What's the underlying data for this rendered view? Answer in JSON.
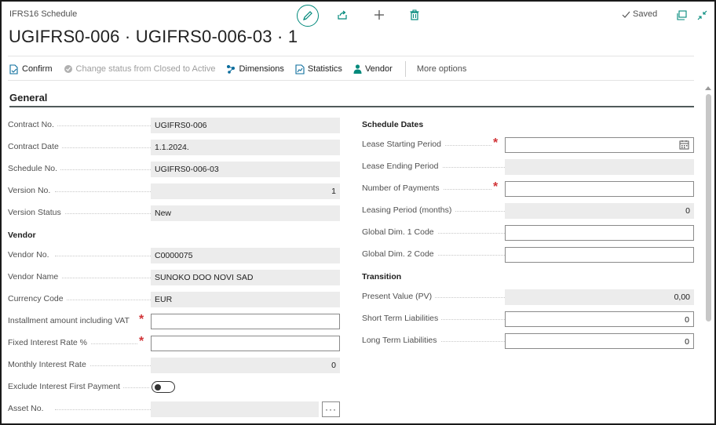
{
  "header": {
    "app_title": "IFRS16 Schedule",
    "record_title": "UGIFRS0-006 · UGIFRS0-006-03 · 1",
    "saved_label": "Saved"
  },
  "actions": {
    "confirm": "Confirm",
    "change_status": "Change status from Closed to Active",
    "dimensions": "Dimensions",
    "statistics": "Statistics",
    "vendor": "Vendor",
    "more_options": "More options"
  },
  "general": {
    "title": "General",
    "left": {
      "contract_no": {
        "label": "Contract No.",
        "value": "UGIFRS0-006"
      },
      "contract_date": {
        "label": "Contract Date",
        "value": "1.1.2024."
      },
      "schedule_no": {
        "label": "Schedule No.",
        "value": "UGIFRS0-006-03"
      },
      "version_no": {
        "label": "Version No.",
        "value": "1"
      },
      "version_status": {
        "label": "Version Status",
        "value": "New"
      },
      "vendor_group": "Vendor",
      "vendor_no": {
        "label": "Vendor No.",
        "value": "C0000075"
      },
      "vendor_name": {
        "label": "Vendor Name",
        "value": "SUNOKO DOO NOVI SAD"
      },
      "currency_code": {
        "label": "Currency Code",
        "value": "EUR"
      },
      "installment_amount": {
        "label": "Installment amount including VAT",
        "value": ""
      },
      "fixed_interest_rate": {
        "label": "Fixed Interest Rate %",
        "value": ""
      },
      "monthly_interest_rate": {
        "label": "Monthly Interest Rate",
        "value": "0"
      },
      "exclude_interest": {
        "label": "Exclude Interest First Payment",
        "value": false
      },
      "asset_no": {
        "label": "Asset No.",
        "value": "",
        "lookup": "···"
      }
    },
    "right": {
      "schedule_dates_group": "Schedule Dates",
      "lease_starting_period": {
        "label": "Lease Starting Period",
        "value": ""
      },
      "lease_ending_period": {
        "label": "Lease Ending Period",
        "value": ""
      },
      "number_of_payments": {
        "label": "Number of Payments",
        "value": ""
      },
      "leasing_period": {
        "label": "Leasing Period (months)",
        "value": "0"
      },
      "global_dim1": {
        "label": "Global Dim. 1 Code",
        "value": ""
      },
      "global_dim2": {
        "label": "Global Dim. 2 Code",
        "value": ""
      },
      "transition_group": "Transition",
      "present_value": {
        "label": "Present Value (PV)",
        "value": "0,00"
      },
      "short_term": {
        "label": "Short Term Liabilities",
        "value": "0"
      },
      "long_term": {
        "label": "Long Term Liabilities",
        "value": "0"
      }
    }
  },
  "colors": {
    "accent": "#00897b",
    "required": "#d13438",
    "readonly_bg": "#ececec"
  }
}
